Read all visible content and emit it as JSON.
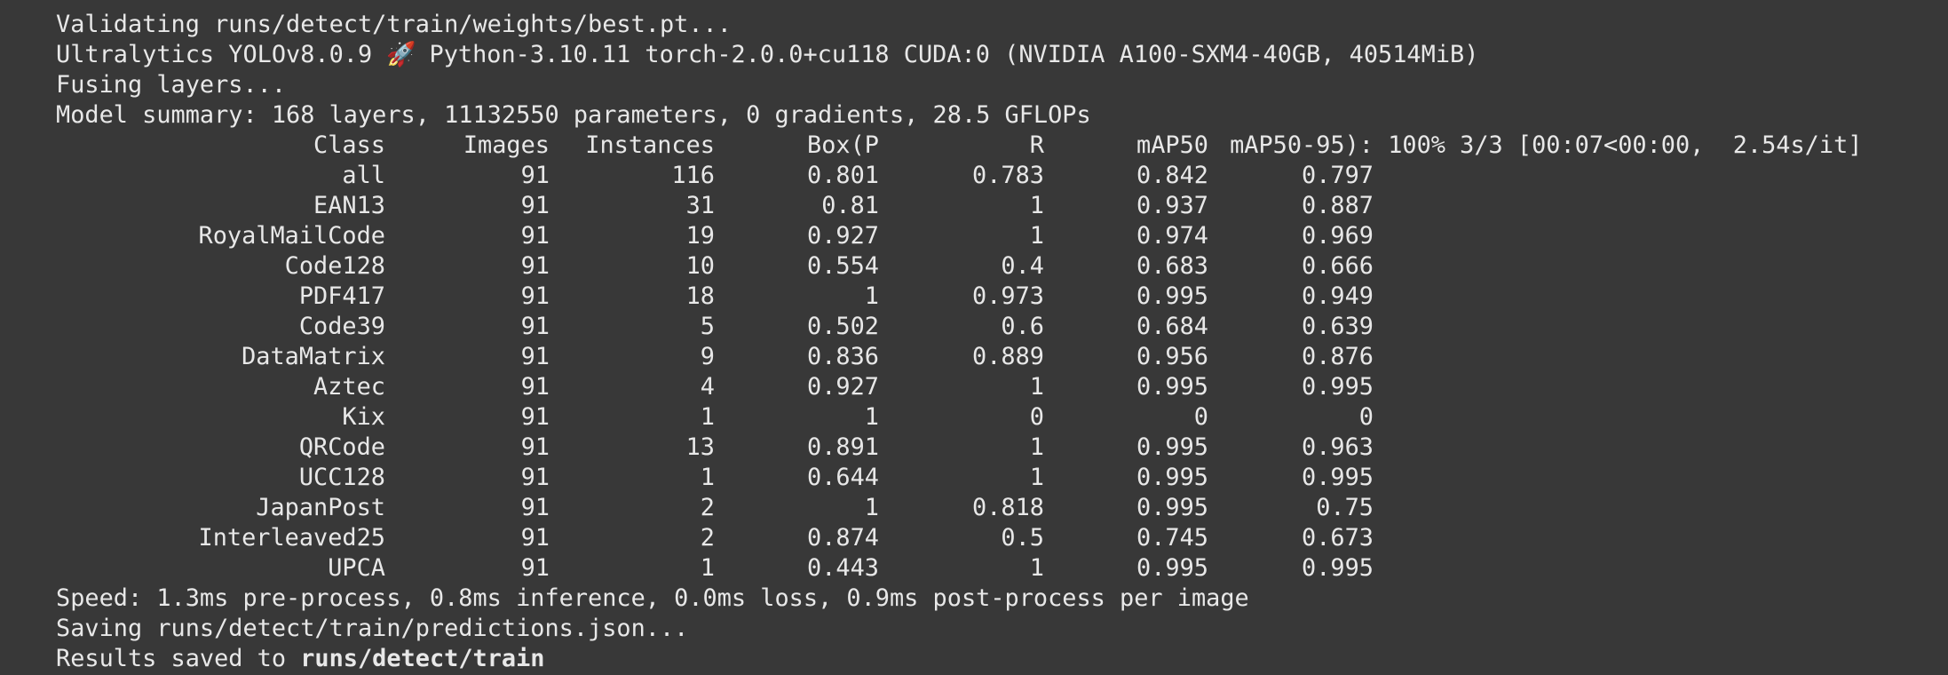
{
  "log": {
    "validating": "Validating runs/detect/train/weights/best.pt...",
    "env_prefix": "Ultralytics YOLOv8.0.9 ",
    "env_emoji": "🚀",
    "env_suffix": " Python-3.10.11 torch-2.0.0+cu118 CUDA:0 (NVIDIA A100-SXM4-40GB, 40514MiB)",
    "fusing": "Fusing layers...",
    "summary": "Model summary: 168 layers, 11132550 parameters, 0 gradients, 28.5 GFLOPs",
    "speed": "Speed: 1.3ms pre-process, 0.8ms inference, 0.0ms loss, 0.9ms post-process per image",
    "saving": "Saving runs/detect/train/predictions.json...",
    "results_prefix": "Results saved to ",
    "results_path": "runs/detect/train"
  },
  "table": {
    "headers": {
      "class": "Class",
      "images": "Images",
      "instances": "Instances",
      "box_p": "Box(P",
      "r": "R",
      "map50": "mAP50",
      "map50_95": "mAP50-95):",
      "progress": " 100% 3/3 [00:07<00:00,  2.54s/it]"
    },
    "rows": [
      {
        "class": "all",
        "images": "91",
        "instances": "116",
        "p": "0.801",
        "r": "0.783",
        "map50": "0.842",
        "map50_95": "0.797"
      },
      {
        "class": "EAN13",
        "images": "91",
        "instances": "31",
        "p": "0.81",
        "r": "1",
        "map50": "0.937",
        "map50_95": "0.887"
      },
      {
        "class": "RoyalMailCode",
        "images": "91",
        "instances": "19",
        "p": "0.927",
        "r": "1",
        "map50": "0.974",
        "map50_95": "0.969"
      },
      {
        "class": "Code128",
        "images": "91",
        "instances": "10",
        "p": "0.554",
        "r": "0.4",
        "map50": "0.683",
        "map50_95": "0.666"
      },
      {
        "class": "PDF417",
        "images": "91",
        "instances": "18",
        "p": "1",
        "r": "0.973",
        "map50": "0.995",
        "map50_95": "0.949"
      },
      {
        "class": "Code39",
        "images": "91",
        "instances": "5",
        "p": "0.502",
        "r": "0.6",
        "map50": "0.684",
        "map50_95": "0.639"
      },
      {
        "class": "DataMatrix",
        "images": "91",
        "instances": "9",
        "p": "0.836",
        "r": "0.889",
        "map50": "0.956",
        "map50_95": "0.876"
      },
      {
        "class": "Aztec",
        "images": "91",
        "instances": "4",
        "p": "0.927",
        "r": "1",
        "map50": "0.995",
        "map50_95": "0.995"
      },
      {
        "class": "Kix",
        "images": "91",
        "instances": "1",
        "p": "1",
        "r": "0",
        "map50": "0",
        "map50_95": "0"
      },
      {
        "class": "QRCode",
        "images": "91",
        "instances": "13",
        "p": "0.891",
        "r": "1",
        "map50": "0.995",
        "map50_95": "0.963"
      },
      {
        "class": "UCC128",
        "images": "91",
        "instances": "1",
        "p": "0.644",
        "r": "1",
        "map50": "0.995",
        "map50_95": "0.995"
      },
      {
        "class": "JapanPost",
        "images": "91",
        "instances": "2",
        "p": "1",
        "r": "0.818",
        "map50": "0.995",
        "map50_95": "0.75"
      },
      {
        "class": "Interleaved25",
        "images": "91",
        "instances": "2",
        "p": "0.874",
        "r": "0.5",
        "map50": "0.745",
        "map50_95": "0.673"
      },
      {
        "class": "UPCA",
        "images": "91",
        "instances": "1",
        "p": "0.443",
        "r": "1",
        "map50": "0.995",
        "map50_95": "0.995"
      }
    ]
  },
  "colors": {
    "background": "#383838",
    "text": "#e8e8e8"
  }
}
